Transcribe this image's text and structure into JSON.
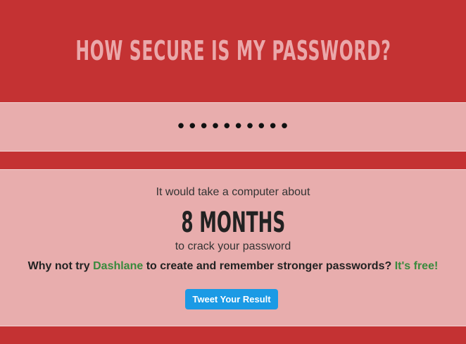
{
  "header": {
    "title": "HOW SECURE IS MY PASSWORD?"
  },
  "password": {
    "masked_value": "••••••••••"
  },
  "result": {
    "lead": "It would take a computer about",
    "duration": "8 MONTHS",
    "tail": "to crack your password",
    "promo_prefix": "Why not try ",
    "promo_link": "Dashlane",
    "promo_middle": " to create and remember stronger passwords? ",
    "promo_free": "It's free!",
    "tweet_label": "Tweet Your Result"
  },
  "colors": {
    "background": "#c43233",
    "band": "#e8adad",
    "title": "#eaa8aa",
    "link": "#3a8a3d",
    "tweet": "#1b9ae5"
  }
}
